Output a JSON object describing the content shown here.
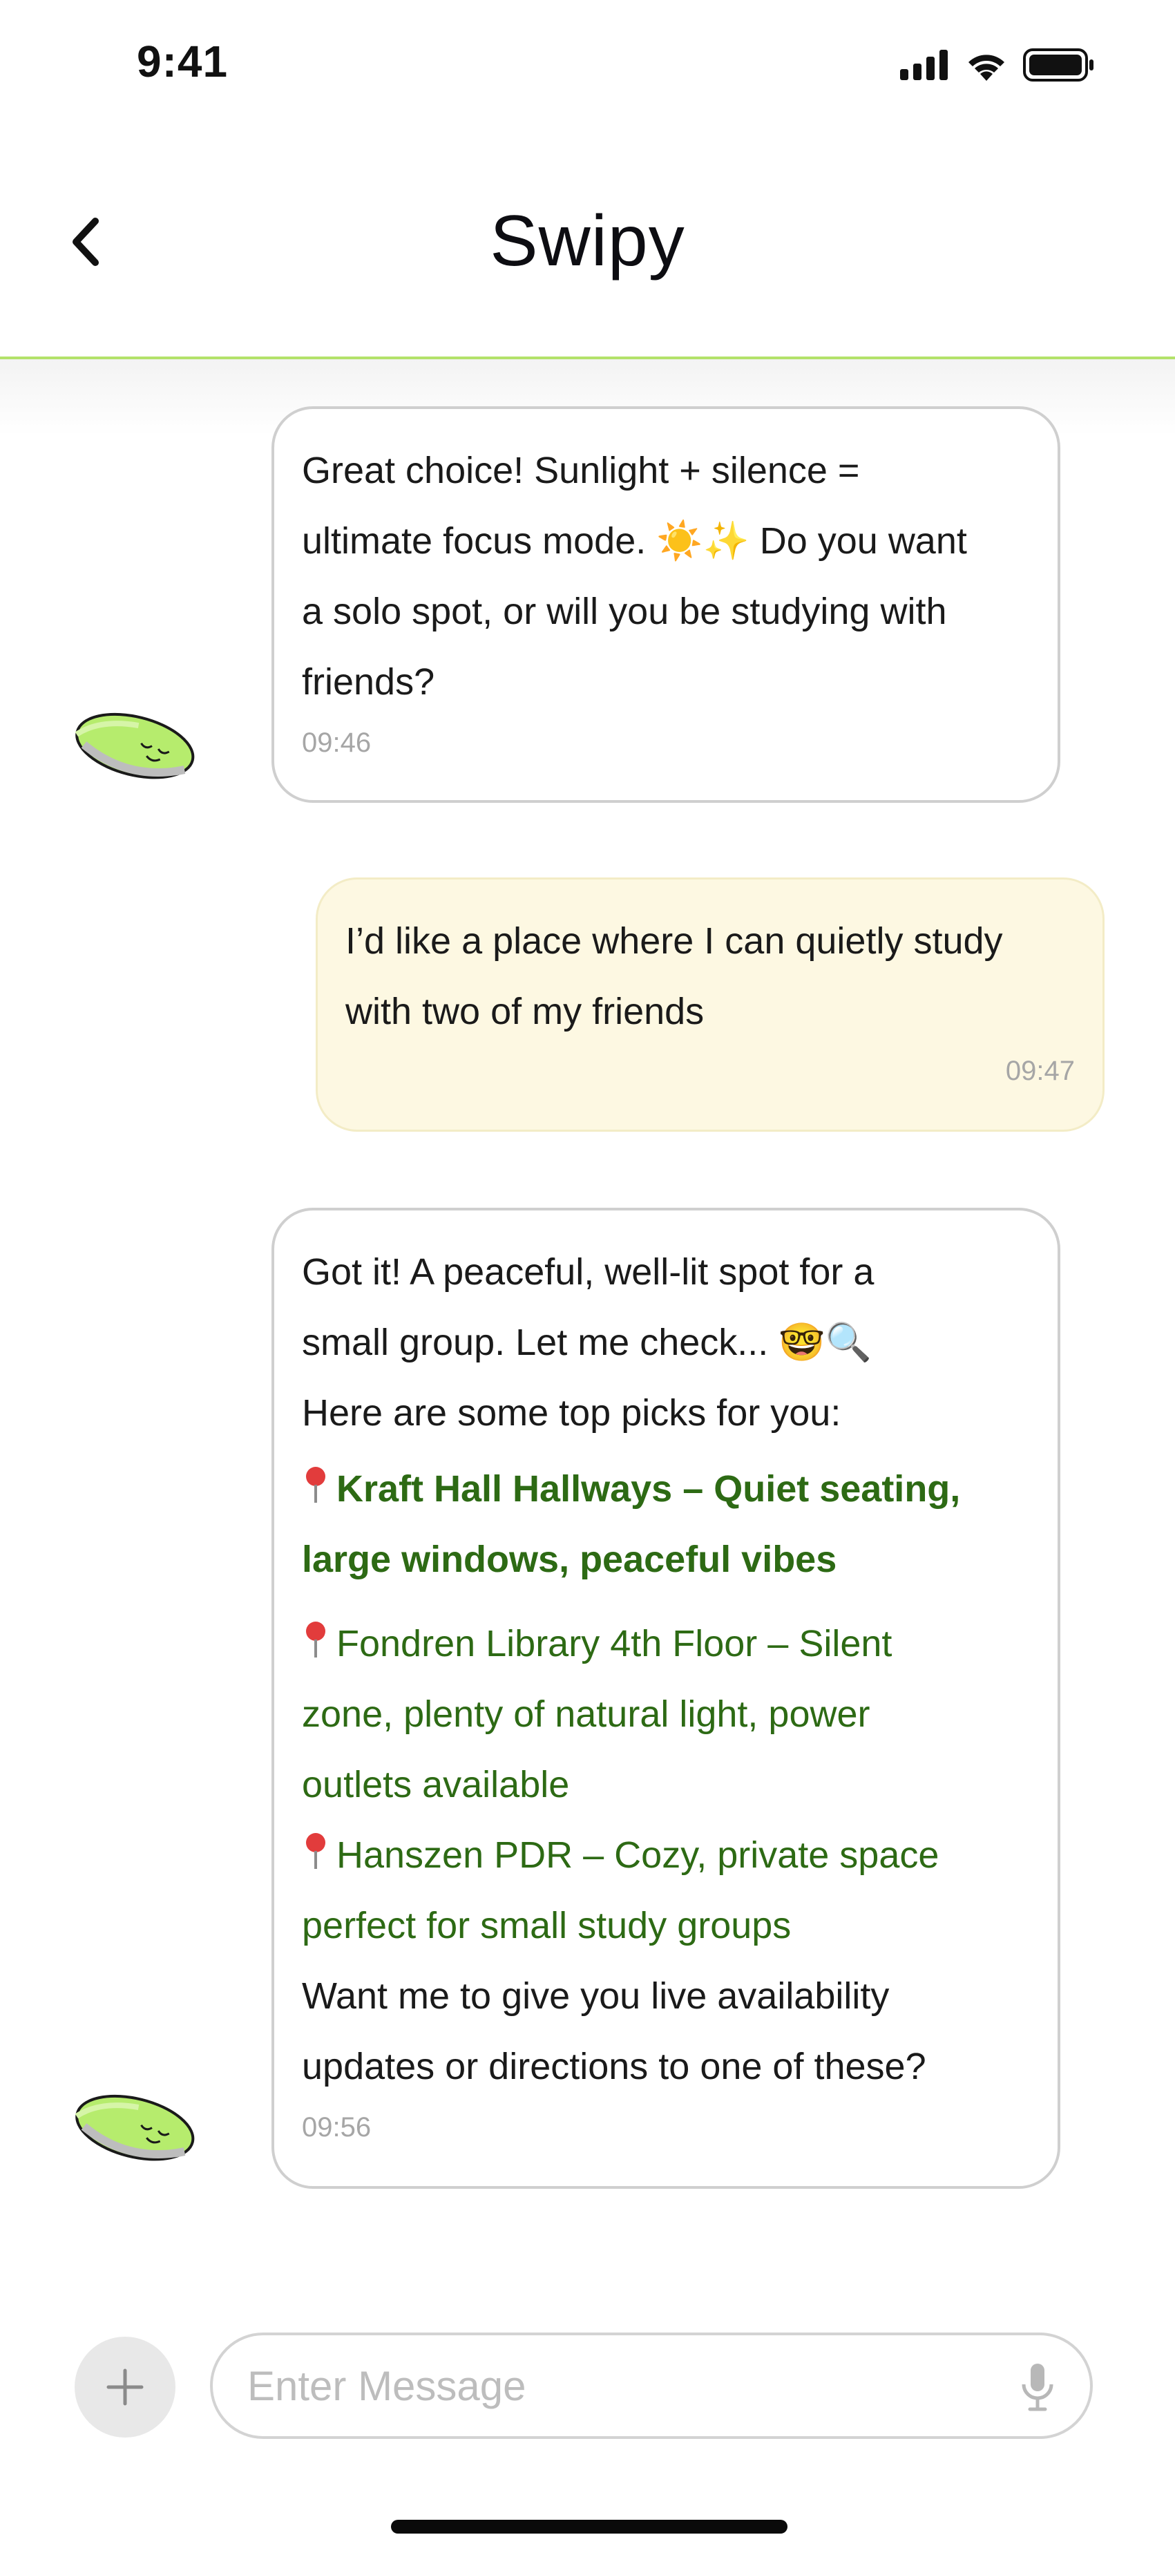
{
  "status_bar": {
    "time": "9:41"
  },
  "header": {
    "title": "Swipy"
  },
  "messages": [
    {
      "sender": "bot",
      "lines": [
        "Great choice! Sunlight + silence =",
        "ultimate focus mode. ☀️✨ Do you want",
        "a solo spot, or will you be studying with",
        "friends?"
      ],
      "time": "09:46"
    },
    {
      "sender": "user",
      "lines": [
        "I’d like a place where I can quietly study",
        "with two of my friends"
      ],
      "time": "09:47"
    },
    {
      "sender": "bot",
      "intro": [
        "Got it! A peaceful, well-lit spot for a",
        "small group. Let me check... 🤓🔍",
        "Here are some top picks for you:"
      ],
      "places": [
        {
          "lines": [
            "Kraft Hall Hallways – Quiet seating,",
            "large windows, peaceful vibes"
          ]
        },
        {
          "lines": [
            "Fondren Library 4th Floor – Silent",
            "zone, plenty of natural light, power",
            "outlets available"
          ]
        },
        {
          "lines": [
            "Hanszen PDR – Cozy, private space",
            "perfect for small study groups"
          ]
        }
      ],
      "outro": [
        "Want me to give you live availability",
        "updates or directions to one of these?"
      ],
      "time": "09:56"
    }
  ],
  "composer": {
    "placeholder": "Enter Message"
  },
  "colors": {
    "accent_green": "#b3e26a",
    "place_text": "#2d6a14",
    "user_bubble": "#fdf8e2",
    "pin_red": "#e23c3c"
  },
  "icons": [
    "back-chevron-icon",
    "signal-icon",
    "wifi-icon",
    "battery-icon",
    "bot-avatar-icon",
    "plus-icon",
    "microphone-icon",
    "pin-icon"
  ]
}
